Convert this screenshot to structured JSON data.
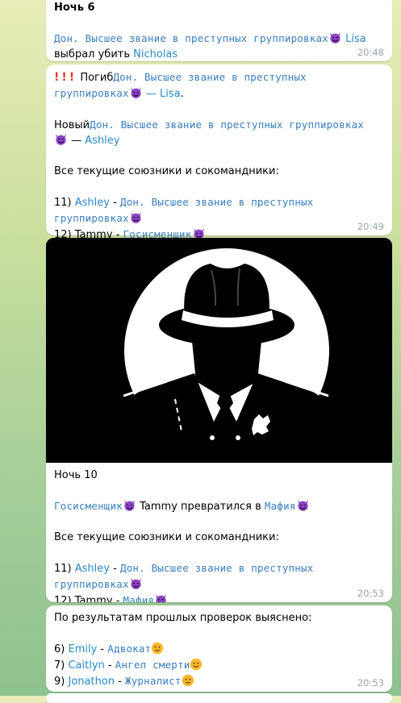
{
  "b1": {
    "night": "Ночь 6",
    "rank": "Дон. Высшее звание в преступных группировках",
    "actor": "Lisa",
    "action": "выбрал убить",
    "target": "Nicholas",
    "time": "20:48"
  },
  "b2": {
    "died_label": "Погиб",
    "rank_a": "Дон. Высшее звание в преступных",
    "rank_b": "группировках",
    "dash_name": "— Lisa",
    "period": ".",
    "new_label": "Новый",
    "new_rank": "Дон. Высшее звание в преступных группировках",
    "dash": "—",
    "new_name": "Ashley",
    "allies": "Все текущие союзники и сокомандники:",
    "a11_num": "11)",
    "a11_name": "Ashley",
    "a11_sep": "-",
    "a11_rank_a": "Дон. Высшее звание в преступных",
    "a11_rank_b": "группировках",
    "a12_num": "12)",
    "a12_name": "Tammy",
    "a12_sep": "-",
    "a12_role": "Госисменщик",
    "time": "20:49"
  },
  "b3": {
    "night": "Ночь 10",
    "role_from": "Госисменщик",
    "name": "Tammy",
    "turned": "превратился в",
    "role_to": "Мафия",
    "allies": "Все текущие союзники и сокомандники:",
    "a11_num": "11)",
    "a11_name": "Ashley",
    "a11_sep": "-",
    "a11_rank_a": "Дон. Высшее звание в преступных",
    "a11_rank_b": "группировках",
    "a12_num": "12)",
    "a12_name": "Tammy",
    "a12_sep": "-",
    "a12_role": "Мафия",
    "time": "20:53"
  },
  "b4": {
    "header": "По результатам прошлых проверок выяснено:",
    "items": [
      {
        "num": "6)",
        "name": "Emily",
        "sep": "-",
        "role": "Адвокат"
      },
      {
        "num": "7)",
        "name": "Caitlyn",
        "sep": "-",
        "role": "Ангел смерти"
      },
      {
        "num": "9)",
        "name": "Jonathon",
        "sep": "-",
        "role": "Журналист"
      }
    ],
    "time": "20:53"
  },
  "colors": {
    "link": "#2a89c9",
    "mono": "#3a7ebf",
    "devil": "#8b43c4",
    "smile": "#f5b82e"
  },
  "icons": {
    "devil": "smiling-devil-emoji",
    "smile": "slightly-smiling-emoji",
    "alert": "exclamation-icon"
  }
}
